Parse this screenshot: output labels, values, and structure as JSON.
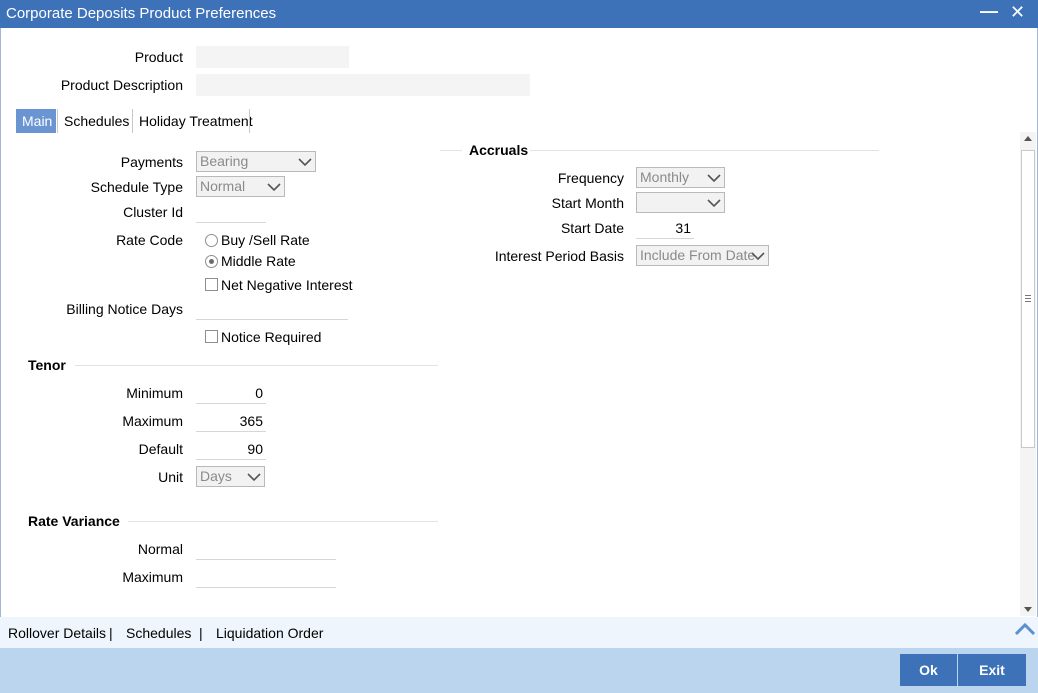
{
  "window": {
    "title": "Corporate Deposits Product Preferences"
  },
  "header": {
    "product_label": "Product",
    "product_value": "",
    "product_description_label": "Product Description",
    "product_description_value": ""
  },
  "tabs": [
    {
      "label": "Main",
      "active": true
    },
    {
      "label": "Schedules",
      "active": false
    },
    {
      "label": "Holiday Treatment",
      "active": false
    }
  ],
  "main": {
    "payments_label": "Payments",
    "payments_value": "Bearing",
    "schedule_type_label": "Schedule Type",
    "schedule_type_value": "Normal",
    "cluster_id_label": "Cluster Id",
    "cluster_id_value": "",
    "rate_code_label": "Rate Code",
    "rate_code_options": [
      {
        "label": "Buy /Sell Rate",
        "selected": false
      },
      {
        "label": "Middle Rate",
        "selected": true
      }
    ],
    "net_negative_interest_label": "Net Negative Interest",
    "net_negative_interest_checked": false,
    "billing_notice_days_label": "Billing Notice Days",
    "billing_notice_days_value": "",
    "notice_required_label": "Notice Required",
    "notice_required_checked": false
  },
  "tenor": {
    "section_title": "Tenor",
    "minimum_label": "Minimum",
    "minimum_value": "0",
    "maximum_label": "Maximum",
    "maximum_value": "365",
    "default_label": "Default",
    "default_value": "90",
    "unit_label": "Unit",
    "unit_value": "Days"
  },
  "rate_variance": {
    "section_title": "Rate Variance",
    "normal_label": "Normal",
    "normal_value": "",
    "maximum_label": "Maximum",
    "maximum_value": ""
  },
  "accruals": {
    "section_title": "Accruals",
    "frequency_label": "Frequency",
    "frequency_value": "Monthly",
    "start_month_label": "Start Month",
    "start_month_value": "",
    "start_date_label": "Start Date",
    "start_date_value": "31",
    "interest_period_basis_label": "Interest Period Basis",
    "interest_period_basis_value": "Include From Date"
  },
  "bottom_links": [
    "Rollover Details",
    "Schedules",
    "Liquidation Order"
  ],
  "footer": {
    "ok_label": "Ok",
    "exit_label": "Exit"
  },
  "colors": {
    "titlebar": "#3d71b8",
    "active_tab": "#6a95d2",
    "footer": "#bcd5ef",
    "button": "#3d71b8"
  }
}
